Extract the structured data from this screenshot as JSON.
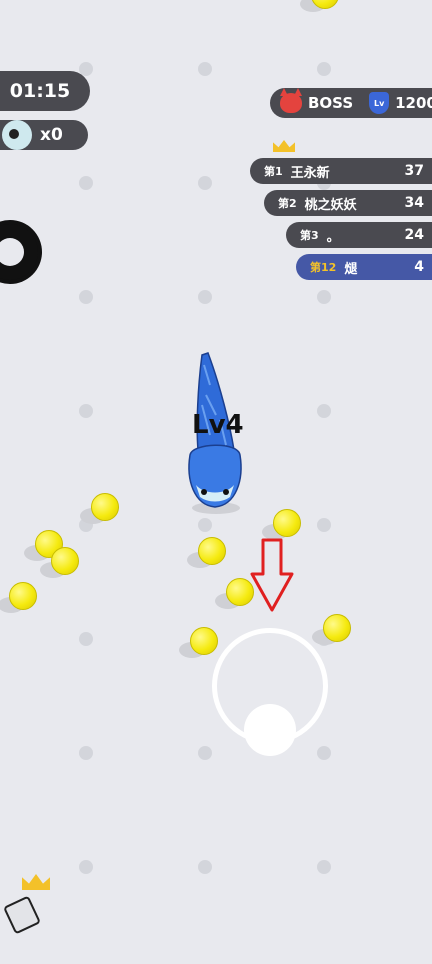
{
  "hud": {
    "timer": "01:15",
    "kills": "x0"
  },
  "boss_bar": {
    "boss_label": "BOSS",
    "lv_badge": "Lv",
    "level_score": "1200"
  },
  "leaderboard": [
    {
      "rank": "第1",
      "name": "王永新",
      "score": "37",
      "highlight": false
    },
    {
      "rank": "第2",
      "name": "桃之妖妖",
      "score": "34",
      "highlight": false
    },
    {
      "rank": "第3",
      "name": "。",
      "score": "24",
      "highlight": false
    },
    {
      "rank": "第12",
      "name": "煺",
      "score": "4",
      "highlight": true
    }
  ],
  "player": {
    "level_label": "Lv4",
    "color": "#2f6bd8"
  },
  "colors": {
    "background": "#e8e9ee",
    "panel": "#4a4a50",
    "player_row": "#4558a6",
    "orb": "#f5ea0f",
    "crown": "#f3c129",
    "arrow": "#e02020"
  }
}
